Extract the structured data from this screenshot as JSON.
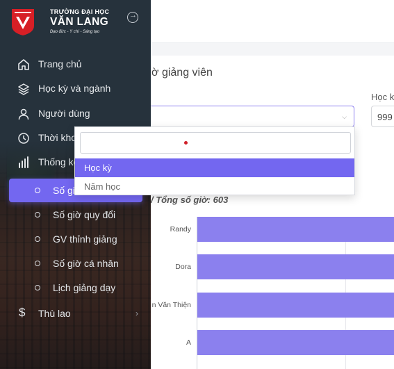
{
  "brand": {
    "line1": "TRƯỜNG ĐẠI HỌC",
    "line2": "VĂN LANG",
    "line3": "Đạo đức - Ý chí - Sáng tạo",
    "accent": "#d71f26"
  },
  "sidebar": {
    "items": [
      {
        "label": "Trang chủ",
        "icon": "home-icon"
      },
      {
        "label": "Học kỳ và ngành",
        "icon": "layers-icon"
      },
      {
        "label": "Người dùng",
        "icon": "user-icon"
      },
      {
        "label": "Thời khoá",
        "icon": "clock-icon"
      },
      {
        "label": "Thống kê",
        "icon": "bar-chart-icon"
      }
    ],
    "subitems": [
      {
        "label": "Số giờ"
      },
      {
        "label": "Số giờ quy đổi"
      },
      {
        "label": "GV thỉnh giảng"
      },
      {
        "label": "Số giờ cá nhân"
      },
      {
        "label": "Lịch giảng dạy"
      }
    ],
    "payment": {
      "label": "Thù lao",
      "icon": "dollar-icon"
    }
  },
  "main": {
    "title": "ờ giảng viên",
    "hk_label": "Học k",
    "year_value": "999",
    "summary": "/ Tổng số giờ: 603"
  },
  "dropdown": {
    "search_value": "",
    "options": [
      "Học kỳ",
      "Năm học"
    ],
    "selected": "Học kỳ"
  },
  "chart_data": {
    "type": "bar",
    "orientation": "horizontal",
    "categories": [
      "Randy",
      "Dora",
      "n Văn Thiện",
      "A"
    ],
    "color": "#8b80ee",
    "grid": true
  },
  "colors": {
    "accent": "#7367f0",
    "sidebar_bg": "#26323c"
  }
}
